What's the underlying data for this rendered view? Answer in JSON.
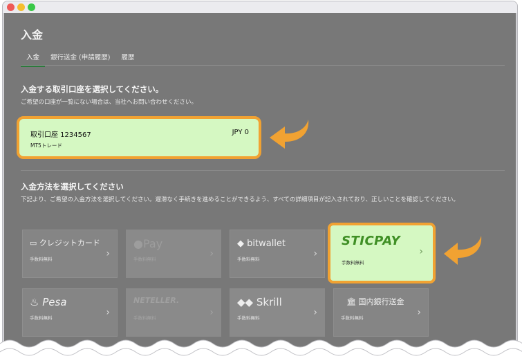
{
  "page": {
    "title": "入金",
    "tabs": [
      "入金",
      "銀行送金 (申請履歴)",
      "履歴"
    ]
  },
  "account_section": {
    "title": "入金する取引口座を選択してください。",
    "subtitle": "ご希望の口座が一覧にない場合は、当社へお問い合わせください。",
    "account": {
      "name": "取引口座 1234567",
      "type": "MT5トレード",
      "balance": "JPY 0"
    }
  },
  "method_section": {
    "title": "入金方法を選択してください",
    "subtitle": "下記より、ご希望の入金方法を選択してください。遅滞なく手続きを進めることができるよう、すべての詳細項目が記入されており、正しいことを確認してください。",
    "methods": [
      {
        "label": "クレジットカード",
        "fee": "手数料無料"
      },
      {
        "label": "Pay",
        "fee": "手数料無料"
      },
      {
        "label": "bitwallet",
        "fee": "手数料無料"
      },
      {
        "label": "STICPAY",
        "fee": "手数料無料"
      },
      {
        "label": "Pesa",
        "fee": "手数料無料"
      },
      {
        "label": "NETELLER.",
        "fee": "手数料無料"
      },
      {
        "label": "Skrill",
        "fee": "手数料無料"
      },
      {
        "label": "国内銀行送金",
        "fee": "手数料無料"
      }
    ]
  },
  "colors": {
    "highlight_border": "#f1a232",
    "highlight_fill": "#d5f8c2",
    "overlay": "#787878",
    "sticpay_green": "#3f8f25"
  }
}
